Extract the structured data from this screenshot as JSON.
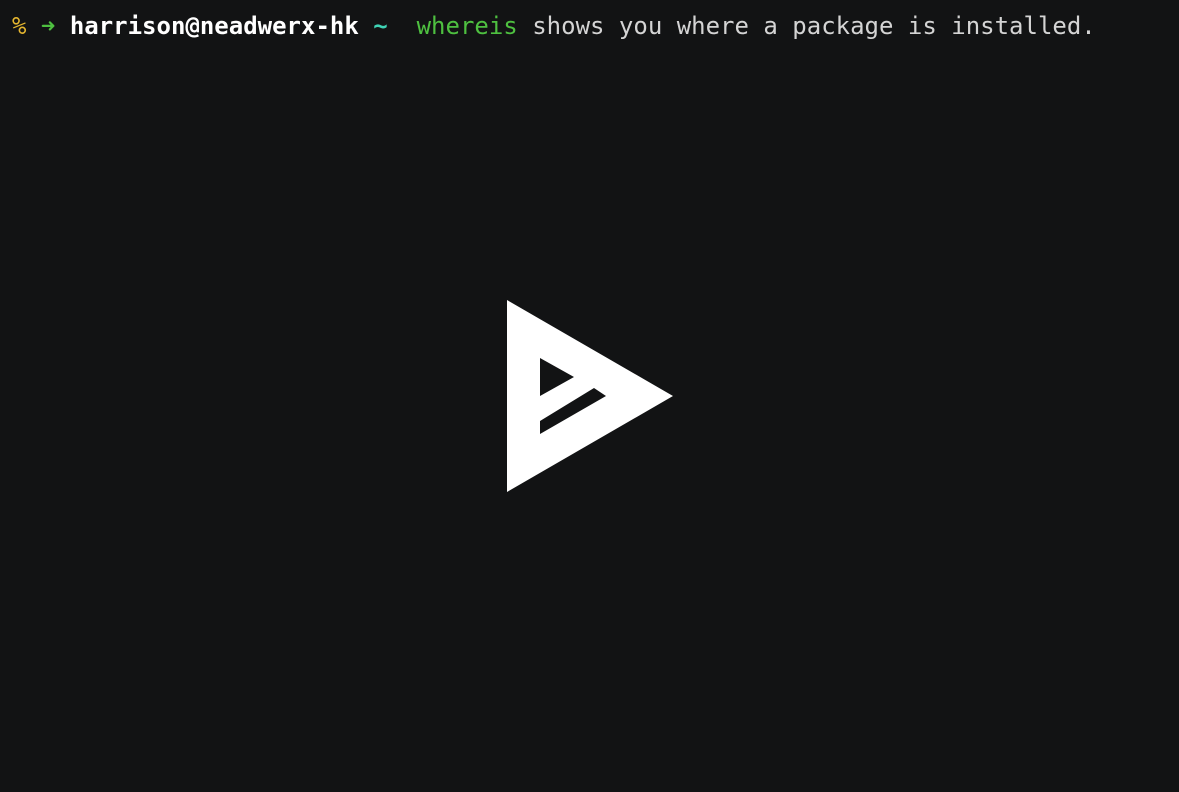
{
  "terminal": {
    "prompt": {
      "status_symbol": "%",
      "arrow": "➜",
      "user_host": "harrison@neadwerx-hk",
      "cwd": "~"
    },
    "command": {
      "name": "whereis",
      "rest": "shows you where a package is installed."
    }
  },
  "player": {
    "play_icon": "asciinema-play-icon"
  },
  "colors": {
    "background": "#121314",
    "prompt_symbol": "#e5b62f",
    "arrow": "#4ec040",
    "user_host": "#ffffff",
    "cwd": "#3fd3b5",
    "command": "#4ec040",
    "text": "#d4d4d4",
    "play_icon": "#ffffff"
  }
}
